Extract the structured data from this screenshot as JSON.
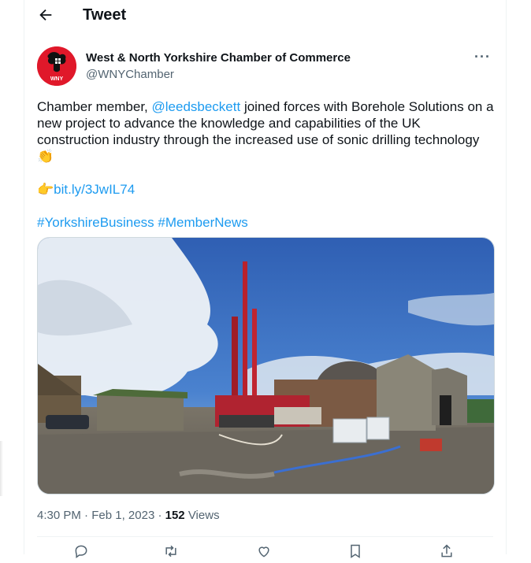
{
  "header": {
    "title": "Tweet"
  },
  "author": {
    "name": "West & North Yorkshire Chamber of Commerce",
    "handle": "@WNYChamber",
    "avatar_text": "WNY",
    "brand_color": "#e0182a"
  },
  "tweet": {
    "line1_pre": "Chamber member, ",
    "mention": "@leedsbeckett",
    "line1_post": " joined forces with Borehole Solutions on a new project to advance the knowledge and capabilities of the UK construction industry through the increased use of sonic drilling technology",
    "clap_emoji": "👏",
    "point_emoji": "👉",
    "link": "bit.ly/3JwIL74",
    "hashtag1": "#YorkshireBusiness",
    "hashtag2": "#MemberNews"
  },
  "meta": {
    "time": "4:30 PM",
    "sep1": " · ",
    "date": "Feb 1, 2023",
    "sep2": " · ",
    "views_count": "152",
    "views_label": " Views"
  },
  "more_label": "···",
  "colors": {
    "link": "#1d9bf0",
    "secondary": "#536471",
    "text": "#0f1419"
  },
  "icons": [
    "back-arrow-icon",
    "more-icon",
    "reply-icon",
    "retweet-icon",
    "like-icon",
    "bookmark-icon",
    "share-icon"
  ]
}
